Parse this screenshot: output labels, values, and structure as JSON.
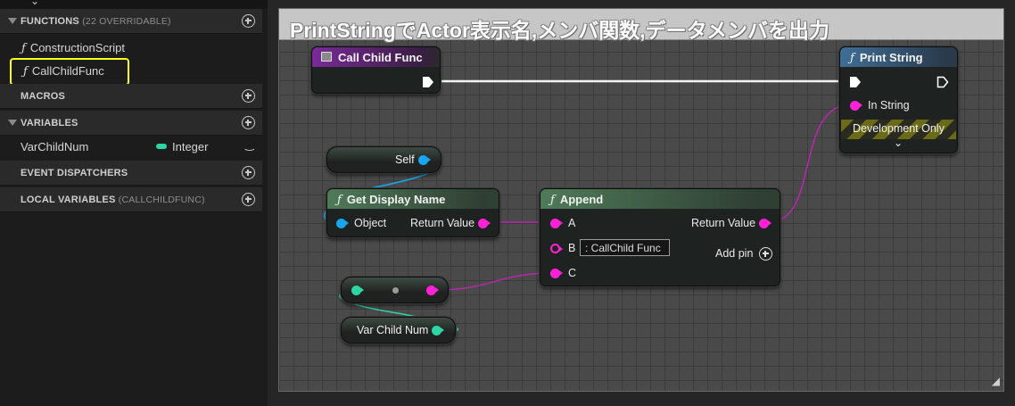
{
  "sidebar": {
    "functions": {
      "title": "FUNCTIONS",
      "subtitle": "(22 OVERRIDABLE)",
      "items": [
        {
          "label": "ConstructionScript",
          "icon": "function-icon"
        },
        {
          "label": "CallChildFunc",
          "icon": "function-icon"
        }
      ]
    },
    "macros": {
      "title": "MACROS"
    },
    "variables": {
      "title": "VARIABLES",
      "items": [
        {
          "label": "VarChildNum",
          "type": "Integer",
          "type_color": "#2ed6a6"
        }
      ]
    },
    "event_dispatchers": {
      "title": "EVENT DISPATCHERS"
    },
    "local_variables": {
      "title": "LOCAL VARIABLES",
      "subtitle": "(CALLCHILDFUNC)"
    }
  },
  "graph": {
    "comment_title": "PrintStringでActor表示名,メンバ関数,データメンバを出力",
    "nodes": {
      "call_child_func": {
        "title": "Call Child Func"
      },
      "print_string": {
        "title": "Print String",
        "in_string_label": "In String",
        "dev_only_label": "Development Only"
      },
      "self": {
        "label": "Self"
      },
      "get_display_name": {
        "title": "Get Display Name",
        "input_label": "Object",
        "output_label": "Return Value"
      },
      "append": {
        "title": "Append",
        "pin_a": "A",
        "pin_b": "B",
        "pin_b_value": ": CallChild Func",
        "pin_c": "C",
        "output_label": "Return Value",
        "add_pin_label": "Add pin"
      },
      "var_child_num": {
        "label": "Var Child Num"
      }
    },
    "colors": {
      "string_pin": "#ff21d7",
      "object_pin": "#18a6ef",
      "integer_pin": "#2ed6a6",
      "exec_wire": "#ffffff",
      "highlight": "#ffff1e"
    }
  }
}
